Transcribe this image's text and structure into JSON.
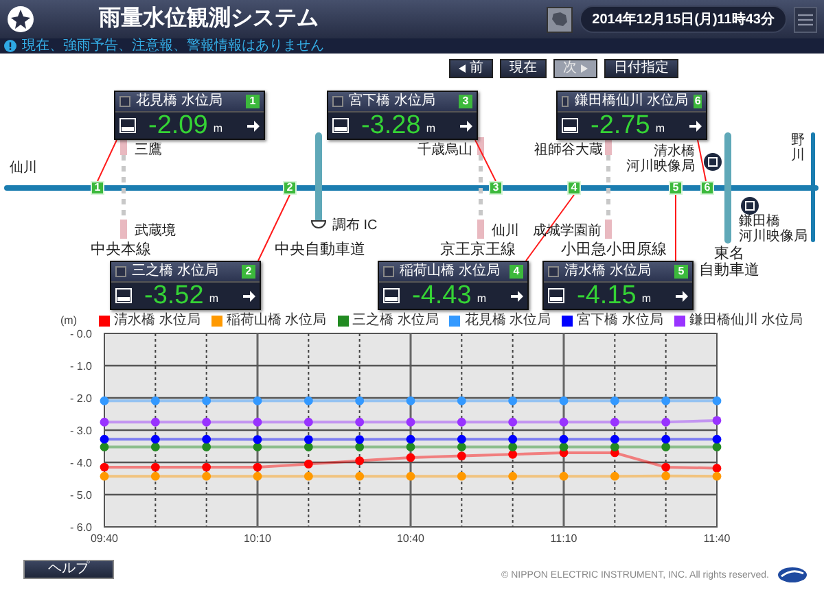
{
  "header": {
    "title": "雨量水位観測システム",
    "datetime": "2014年12月15日(月)11時43分"
  },
  "notice": "現在、強雨予告、注意報、警報情報はありません",
  "nav_buttons": [
    {
      "label": "前",
      "kind": "prev",
      "disabled": false
    },
    {
      "label": "現在",
      "kind": "plain",
      "disabled": false
    },
    {
      "label": "次",
      "kind": "next",
      "disabled": true
    },
    {
      "label": "日付指定",
      "kind": "plain",
      "disabled": false
    }
  ],
  "map": {
    "river": "仙川",
    "tributary": "野川",
    "rail_lines": [
      {
        "name": "中央本線",
        "north_station": "三鷹",
        "south_station": "武蔵境"
      },
      {
        "name": "京王京王線",
        "north_station": "千歳烏山",
        "south_station": "仙川"
      },
      {
        "name": "小田急小田原線",
        "north_station": "祖師谷大蔵",
        "south_station": "成城学園前"
      }
    ],
    "highways": [
      {
        "name_lines": [
          "中央自動車道"
        ],
        "interchange": "調布 IC"
      },
      {
        "name_lines": [
          "東名",
          "自動車道"
        ]
      }
    ],
    "cameras": [
      {
        "name_lines": [
          "清水橋",
          "河川映像局"
        ]
      },
      {
        "name_lines": [
          "鎌田橋",
          "河川映像局"
        ]
      }
    ],
    "stations": [
      {
        "number": "1",
        "name": "花見橋 水位局",
        "value": "-2.09",
        "unit": "m",
        "checked": false
      },
      {
        "number": "3",
        "name": "宮下橋 水位局",
        "value": "-3.28",
        "unit": "m",
        "checked": false
      },
      {
        "number": "6",
        "name": "鎌田橋仙川 水位局",
        "value": "-2.75",
        "unit": "m",
        "checked": false
      },
      {
        "number": "2",
        "name": "三之橋 水位局",
        "value": "-3.52",
        "unit": "m",
        "checked": false
      },
      {
        "number": "4",
        "name": "稲荷山橋 水位局",
        "value": "-4.43",
        "unit": "m",
        "checked": false
      },
      {
        "number": "5",
        "name": "清水橋 水位局",
        "value": "-4.15",
        "unit": "m",
        "checked": false
      }
    ],
    "river_markers": [
      "1",
      "2",
      "3",
      "4",
      "5",
      "6"
    ]
  },
  "chart": {
    "chart_data": {
      "type": "line",
      "ylabel": "(m)",
      "categories": [
        "09:40",
        null,
        null,
        "10:10",
        null,
        null,
        "10:40",
        null,
        null,
        "11:10",
        null,
        null,
        "11:40"
      ],
      "ylim": [
        -6,
        0
      ],
      "grid": true,
      "yticks": [
        {
          "value": 0,
          "label": "- 0.0"
        },
        {
          "value": -1,
          "label": "- 1.0"
        },
        {
          "value": -2,
          "label": "- 2.0"
        },
        {
          "value": -3,
          "label": "- 3.0"
        },
        {
          "value": -4,
          "label": "- 4.0"
        },
        {
          "value": -5,
          "label": "- 5.0"
        },
        {
          "value": -6,
          "label": "- 6.0"
        }
      ],
      "series": [
        {
          "name": "清水橋 水位局",
          "color": "#ff0000",
          "marker": true,
          "values": [
            -4.15,
            -4.15,
            -4.15,
            -4.15,
            -4.05,
            -3.95,
            -3.85,
            -3.8,
            -3.75,
            -3.7,
            -3.7,
            -4.15,
            -4.18
          ]
        },
        {
          "name": "稲荷山橋 水位局",
          "color": "#ff9900",
          "marker": true,
          "values": [
            -4.43,
            -4.43,
            -4.43,
            -4.43,
            -4.43,
            -4.43,
            -4.43,
            -4.43,
            -4.43,
            -4.43,
            -4.43,
            -4.42,
            -4.43
          ]
        },
        {
          "name": "三之橋 水位局",
          "color": "#228b22",
          "marker": true,
          "values": [
            -3.52,
            -3.52,
            -3.52,
            -3.52,
            -3.52,
            -3.52,
            -3.52,
            -3.52,
            -3.52,
            -3.52,
            -3.52,
            -3.52,
            -3.52
          ]
        },
        {
          "name": "花見橋 水位局",
          "color": "#3399ff",
          "marker": true,
          "values": [
            -2.09,
            -2.09,
            -2.09,
            -2.09,
            -2.09,
            -2.09,
            -2.09,
            -2.09,
            -2.09,
            -2.09,
            -2.09,
            -2.09,
            -2.09
          ]
        },
        {
          "name": "宮下橋 水位局",
          "color": "#0000ff",
          "marker": true,
          "values": [
            -3.28,
            -3.28,
            -3.28,
            -3.29,
            -3.29,
            -3.29,
            -3.28,
            -3.28,
            -3.28,
            -3.28,
            -3.28,
            -3.28,
            -3.28
          ]
        },
        {
          "name": "鎌田橋仙川 水位局",
          "color": "#9933ff",
          "marker": true,
          "values": [
            -2.75,
            -2.75,
            -2.75,
            -2.75,
            -2.75,
            -2.75,
            -2.75,
            -2.75,
            -2.75,
            -2.75,
            -2.75,
            -2.75,
            -2.7
          ]
        }
      ]
    }
  },
  "footer": {
    "help": "ヘルプ",
    "copyright": "© NIPPON ELECTRIC INSTRUMENT, INC. All rights reserved."
  }
}
